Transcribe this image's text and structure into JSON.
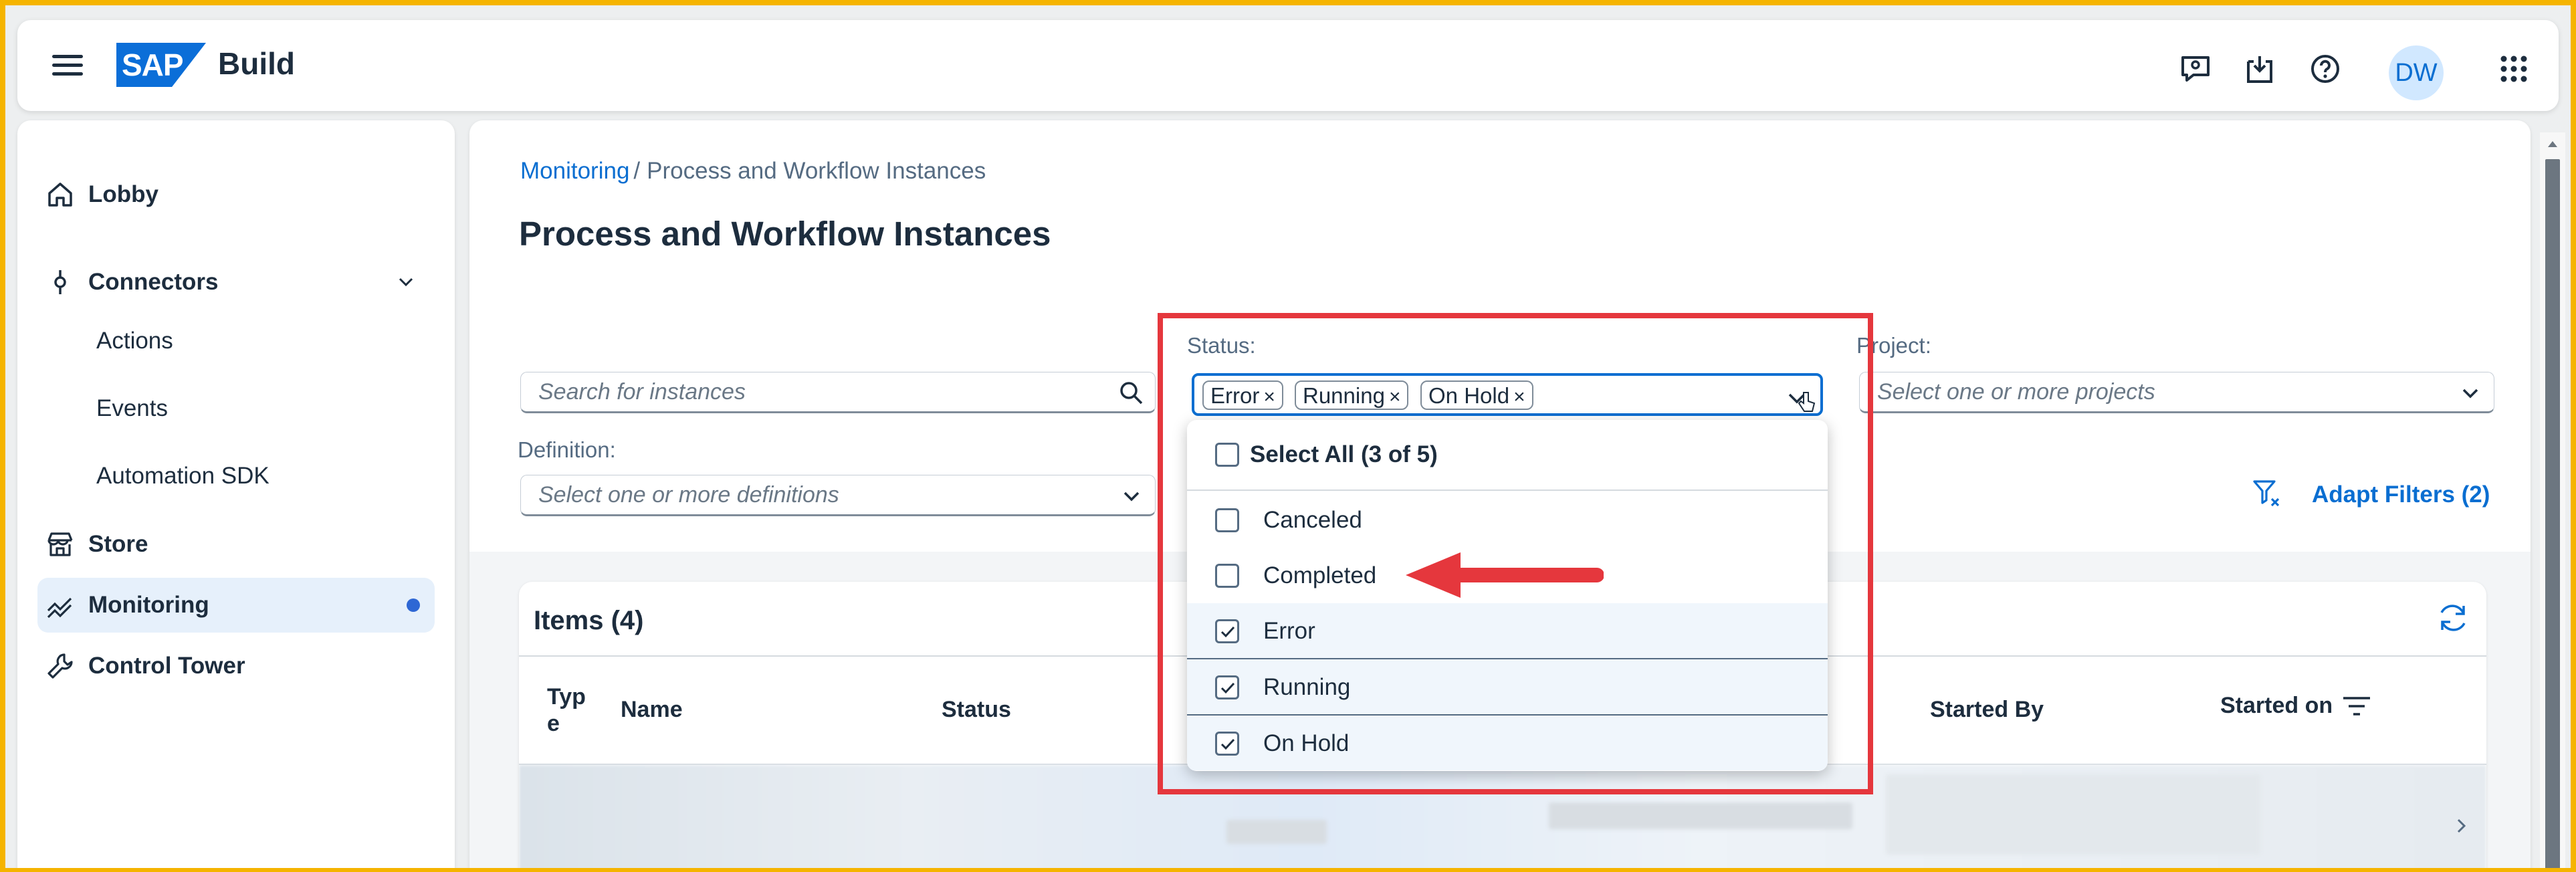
{
  "shell": {
    "brand_logo": "SAP",
    "brand_name": "Build",
    "avatar_initials": "DW",
    "icons": [
      "feedback-icon",
      "inbox-download-icon",
      "help-icon",
      "app-grid-icon"
    ]
  },
  "nav": {
    "items": [
      {
        "label": "Lobby",
        "icon": "home-icon"
      },
      {
        "label": "Connectors",
        "icon": "connector-icon"
      },
      {
        "label": "Store",
        "icon": "store-icon"
      },
      {
        "label": "Monitoring",
        "icon": "monitoring-icon"
      },
      {
        "label": "Control Tower",
        "icon": "wrench-icon"
      }
    ],
    "connectors_sub": [
      "Actions",
      "Events",
      "Automation SDK"
    ]
  },
  "breadcrumb": {
    "link": "Monitoring",
    "separator": "/",
    "current": "Process and Workflow Instances"
  },
  "page_title": "Process and Workflow Instances",
  "filters": {
    "search_placeholder": "Search for instances",
    "status_label": "Status:",
    "project_label": "Project:",
    "project_placeholder": "Select one or more projects",
    "definition_label": "Definition:",
    "definition_placeholder": "Select one or more definitions",
    "adapt_filters": "Adapt Filters (2)",
    "status_tokens": [
      "Error",
      "Running",
      "On Hold"
    ],
    "token_remove": "×"
  },
  "status_dropdown": {
    "select_all": "Select All (3 of 5)",
    "options": [
      {
        "label": "Canceled",
        "checked": false
      },
      {
        "label": "Completed",
        "checked": false
      },
      {
        "label": "Error",
        "checked": true
      },
      {
        "label": "Running",
        "checked": true
      },
      {
        "label": "On Hold",
        "checked": true
      }
    ]
  },
  "table": {
    "title": "Items (4)",
    "columns": [
      "Typ\ne",
      "Name",
      "Status",
      "Started By",
      "Started on"
    ]
  },
  "colors": {
    "accent": "#0a6ed1",
    "annotation": "#e5373d"
  }
}
